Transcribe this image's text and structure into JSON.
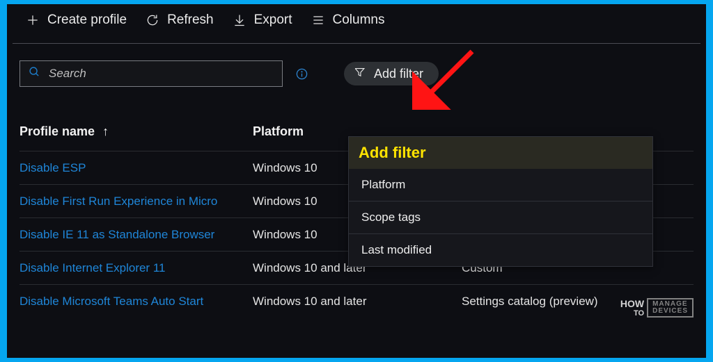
{
  "toolbar": {
    "create": "Create profile",
    "refresh": "Refresh",
    "export": "Export",
    "columns": "Columns"
  },
  "search": {
    "placeholder": "Search",
    "value": ""
  },
  "filter_button": "Add filter",
  "table": {
    "headers": {
      "name": "Profile name",
      "platform": "Platform",
      "type": ""
    },
    "rows": [
      {
        "name": "Disable ESP",
        "platform": "Windows 10",
        "type": ""
      },
      {
        "name": "Disable First Run Experience in Micro",
        "platform": "Windows 10",
        "type": ""
      },
      {
        "name": "Disable IE 11 as Standalone Browser",
        "platform": "Windows 10",
        "type": ""
      },
      {
        "name": "Disable Internet Explorer 11",
        "platform": "Windows 10 and later",
        "type": "Custom"
      },
      {
        "name": "Disable Microsoft Teams Auto Start",
        "platform": "Windows 10 and later",
        "type": "Settings catalog (preview)"
      }
    ]
  },
  "filter_dropdown": {
    "title": "Add filter",
    "items": [
      "Platform",
      "Scope tags",
      "Last modified"
    ]
  },
  "watermark": {
    "how": "HOW",
    "to": "TO",
    "l1": "MANAGE",
    "l2": "DEVICES"
  }
}
